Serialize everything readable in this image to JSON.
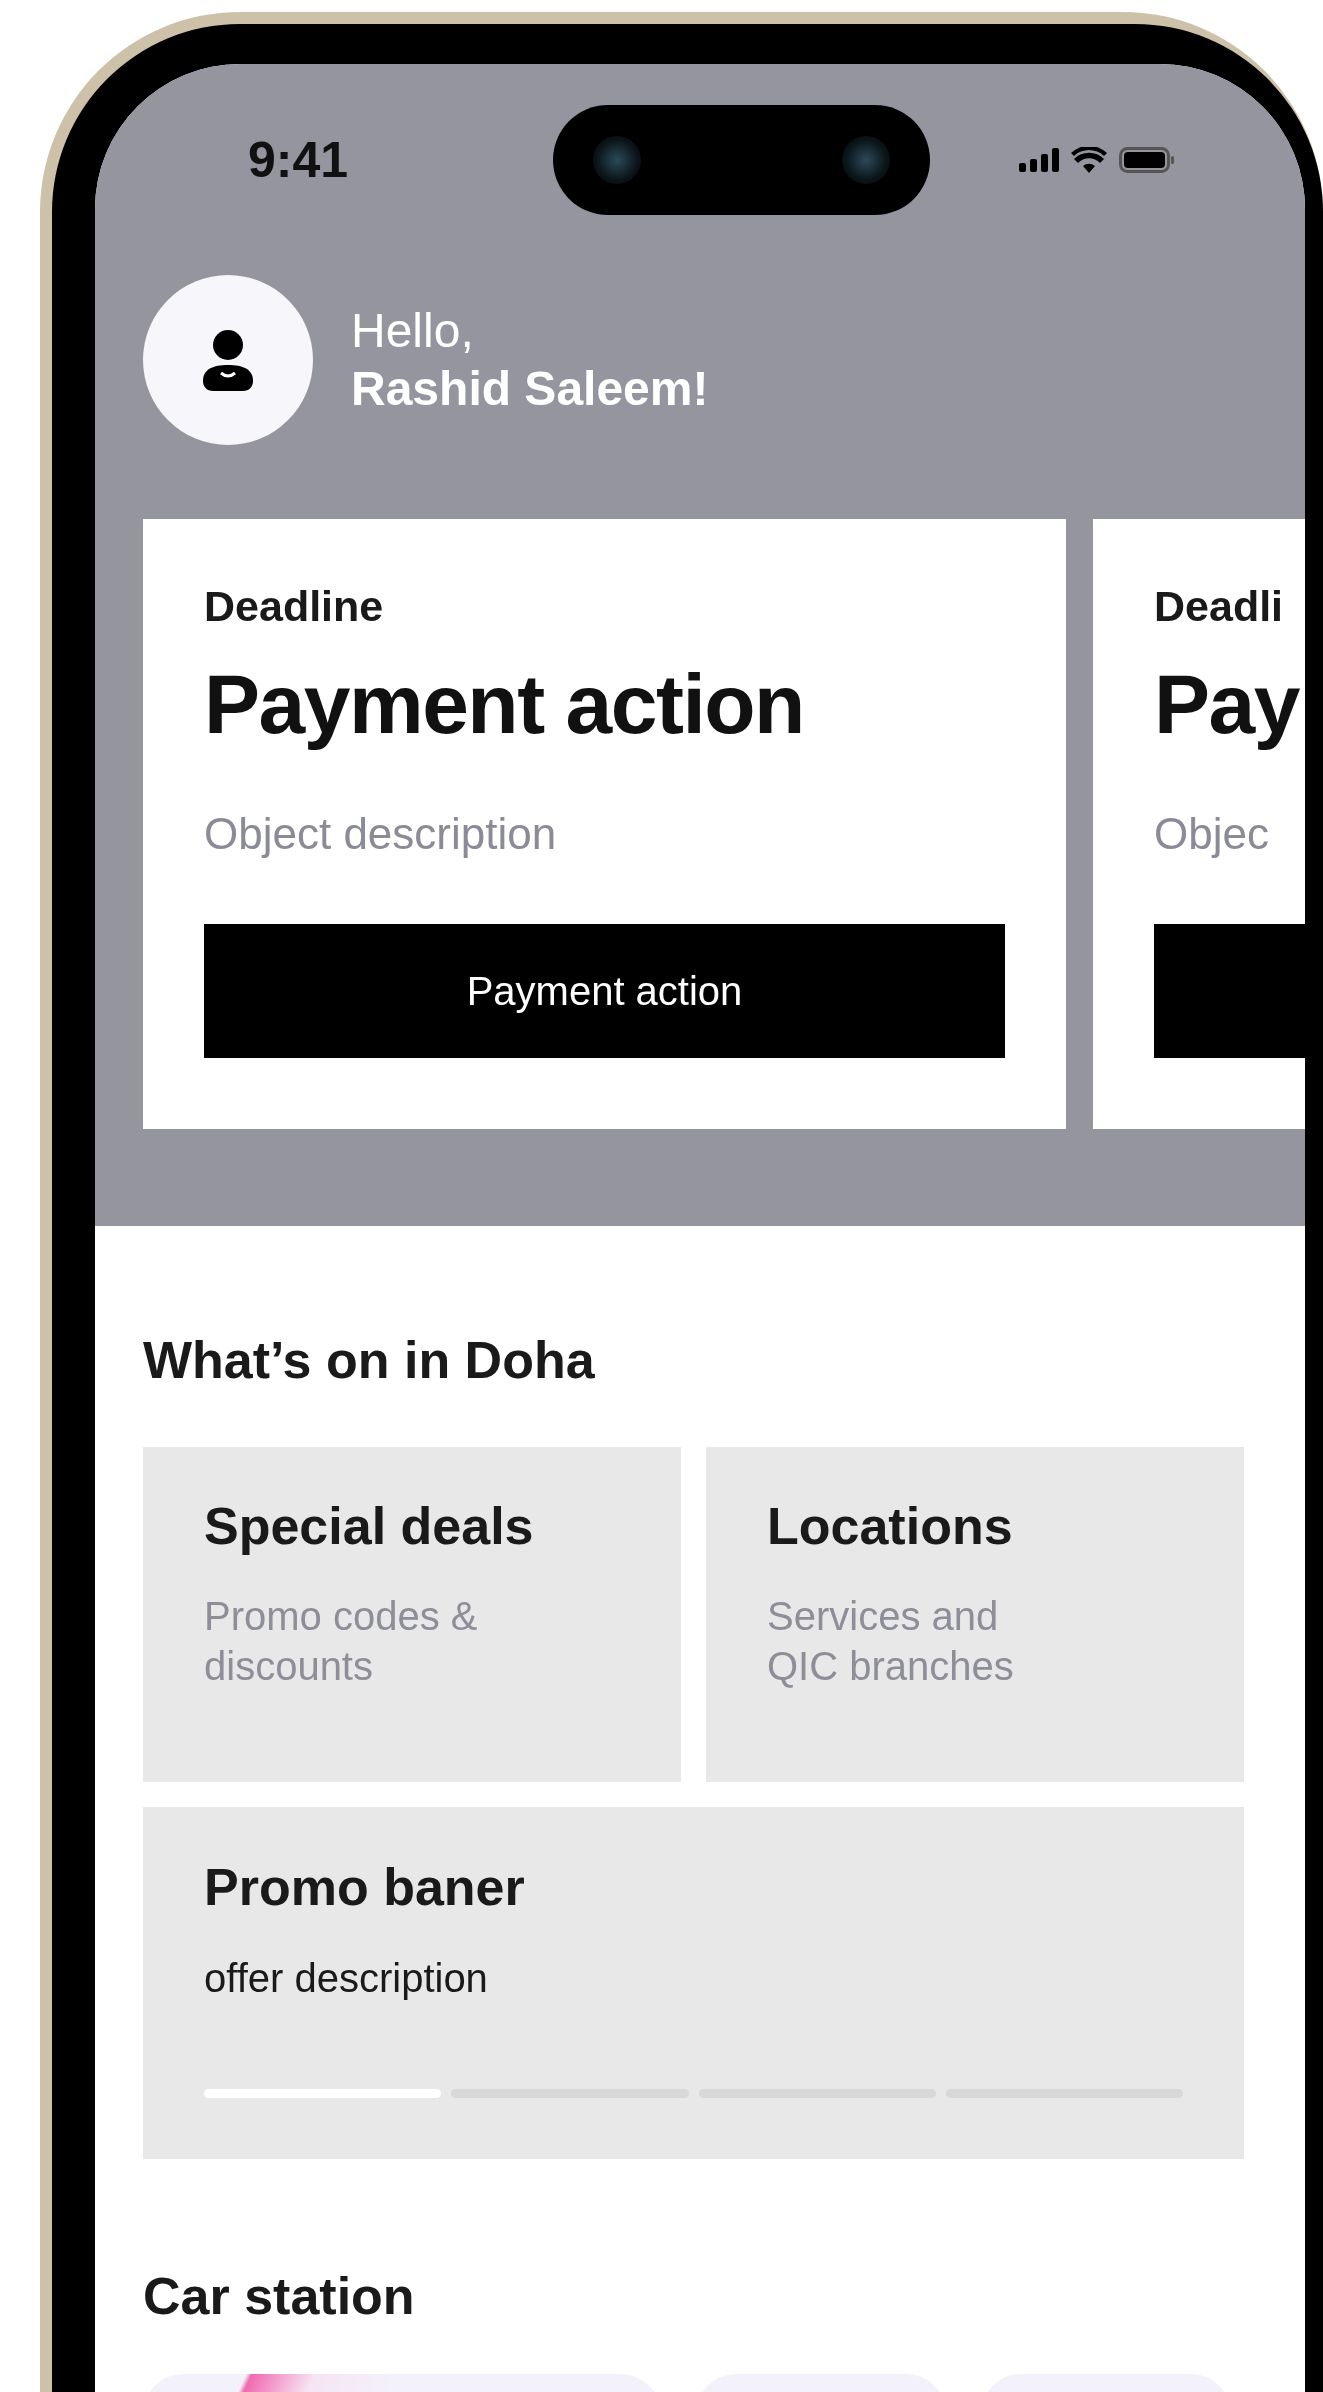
{
  "status_bar": {
    "time": "9:41"
  },
  "greeting": {
    "hello": "Hello,",
    "name": "Rashid Saleem!"
  },
  "payment_cards": [
    {
      "label": "Deadline",
      "title": "Payment action",
      "description": "Object description",
      "button_label": "Payment action"
    },
    {
      "label": "Deadli",
      "title": "Pay",
      "description": "Objec"
    }
  ],
  "whats_on": {
    "title": "What’s on in Doha",
    "tiles": [
      {
        "title": "Special deals",
        "subtitle": "Promo codes & discounts"
      },
      {
        "title": "Locations",
        "subtitle": "Services and QIC branches"
      }
    ],
    "promo": {
      "title": "Promo baner",
      "description": "offer description",
      "pages": [
        {
          "selected": true
        },
        {
          "selected": false
        },
        {
          "selected": false
        },
        {
          "selected": false
        }
      ]
    }
  },
  "car_station": {
    "title": "Car station",
    "cards": [
      {
        "kind": "gradient"
      },
      {
        "kind": "plain"
      },
      {
        "kind": "plain"
      }
    ]
  }
}
